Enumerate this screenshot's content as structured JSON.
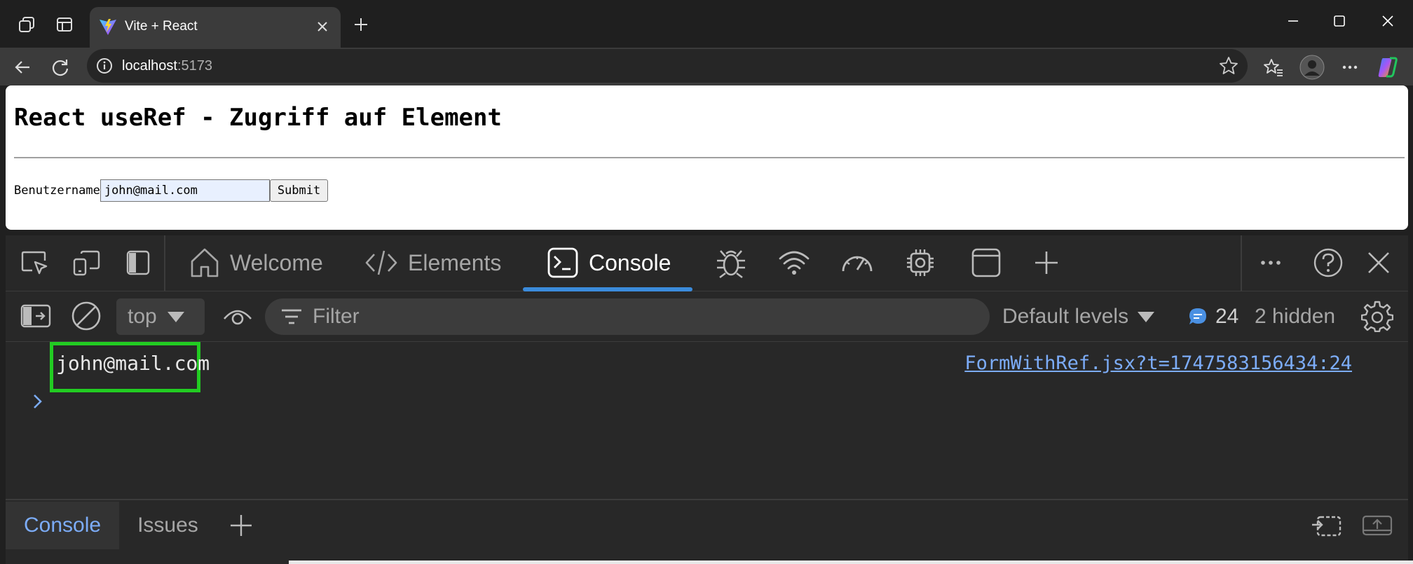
{
  "browser": {
    "tab": {
      "title": "Vite + React"
    },
    "address": {
      "host": "localhost",
      "port": ":5173"
    }
  },
  "page": {
    "title": "React useRef - Zugriff auf Element",
    "form": {
      "label": "Benutzername",
      "input_value": "john@mail.com",
      "submit_label": "Submit"
    }
  },
  "devtools": {
    "tabs": [
      {
        "label": "Welcome",
        "icon": "home-icon"
      },
      {
        "label": "Elements",
        "icon": "code-icon"
      },
      {
        "label": "Console",
        "icon": "console-icon"
      }
    ],
    "context": "top",
    "filter_placeholder": "Filter",
    "levels": "Default levels",
    "message_count": "24",
    "hidden": "2 hidden",
    "console": {
      "log_value": "john@mail.com",
      "log_source": "FormWithRef.jsx?t=1747583156434:24"
    },
    "drawer": {
      "tabs": [
        "Console",
        "Issues"
      ]
    }
  },
  "colors": {
    "accent_blue": "#3b8bdb",
    "link_blue": "#7cacf8",
    "highlight_green": "#22cc22"
  }
}
